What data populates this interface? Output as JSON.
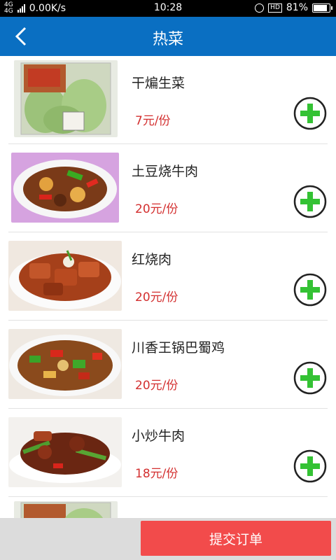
{
  "status_bar": {
    "network": "4G 4G",
    "speed": "0.00K/s",
    "time": "10:28",
    "hd": "HD",
    "battery": "81%"
  },
  "header": {
    "title": "热菜",
    "back_icon": "chevron-left-icon",
    "color": "#0a6fc2"
  },
  "dishes": [
    {
      "name": "干煸生菜",
      "price": "7元/份"
    },
    {
      "name": "土豆烧牛肉",
      "price": "20元/份"
    },
    {
      "name": "红烧肉",
      "price": "20元/份"
    },
    {
      "name": "川香王锅巴蜀鸡",
      "price": "20元/份"
    },
    {
      "name": "小炒牛肉",
      "price": "18元/份"
    }
  ],
  "add_icon": "plus-circle-icon",
  "accent_green": "#34c234",
  "footer": {
    "submit_label": "提交订单",
    "submit_color": "#f24b4b"
  }
}
